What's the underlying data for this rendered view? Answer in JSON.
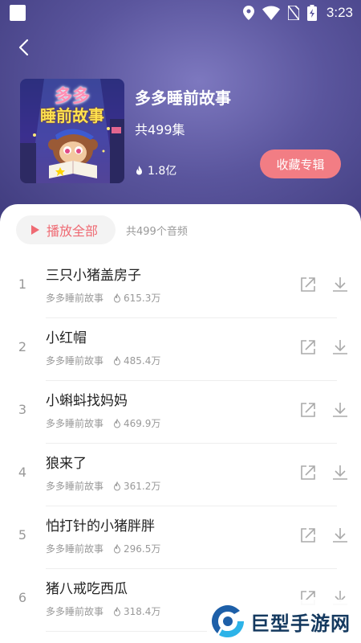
{
  "status_bar": {
    "time": "3:23"
  },
  "album": {
    "cover_title_line1": "多多",
    "cover_title_line2": "睡前故事",
    "title": "多多睡前故事",
    "episode_count": "共499集",
    "plays": "1.8亿",
    "collect_label": "收藏专辑"
  },
  "list": {
    "play_all_label": "播放全部",
    "total_label": "共499个音频",
    "tracks": [
      {
        "index": "1",
        "title": "三只小猪盖房子",
        "album": "多多睡前故事",
        "plays": "615.3万"
      },
      {
        "index": "2",
        "title": "小红帽",
        "album": "多多睡前故事",
        "plays": "485.4万"
      },
      {
        "index": "3",
        "title": "小蝌蚪找妈妈",
        "album": "多多睡前故事",
        "plays": "469.9万"
      },
      {
        "index": "4",
        "title": "狼来了",
        "album": "多多睡前故事",
        "plays": "361.2万"
      },
      {
        "index": "5",
        "title": "怕打针的小猪胖胖",
        "album": "多多睡前故事",
        "plays": "296.5万"
      },
      {
        "index": "6",
        "title": "猪八戒吃西瓜",
        "album": "多多睡前故事",
        "plays": "318.4万"
      }
    ]
  },
  "watermark": {
    "text": "巨型手游网"
  },
  "colors": {
    "accent": "#f27d84",
    "play_accent": "#ef6a73",
    "header": "#5a559d"
  }
}
